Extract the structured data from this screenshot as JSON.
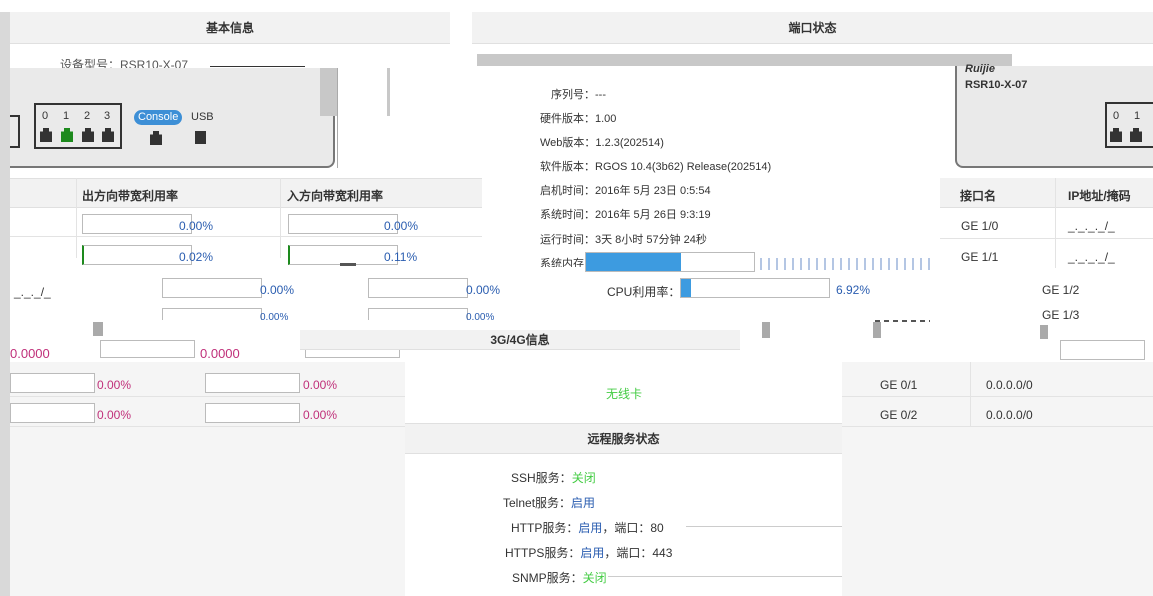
{
  "basic": {
    "title": "基本信息",
    "model_prefix": "设备型号：RSR10-X-07",
    "serial_label": "序列号：",
    "serial_value": "---",
    "hw_label": "硬件版本：",
    "hw_value": "1.00",
    "web_label": "Web版本：",
    "web_value": "1.2.3(202514)",
    "sw_label": "软件版本：",
    "sw_value": "RGOS 10.4(3b62) Release(202514)",
    "boot_label": "启机时间：",
    "boot_value": "2016年 5月 23日 0:5:54",
    "systime_label": "系统时间：",
    "systime_value": "2016年 5月 26日 9:3:19",
    "uptime_label": "运行时间：",
    "uptime_value": "3天 8小时 57分钟 24秒",
    "mem_label": "系统内存：",
    "cpu_label": "CPU利用率：",
    "cpu_pct": "6.92%",
    "cpu_fraction": 0.0692
  },
  "port_status": {
    "title": "端口状态",
    "brand": "Ruijie",
    "model": "RSR10-X-07",
    "port_numbers": [
      "0",
      "1",
      "2",
      "3"
    ],
    "console_label": "Console",
    "usb_label": "USB",
    "right_port_numbers": [
      "0",
      "1"
    ]
  },
  "bandwidth": {
    "out_header": "出方向带宽利用率",
    "in_header": "入方向带宽利用率",
    "rows": [
      {
        "out": "0.00%",
        "in": "0.00%",
        "out_frac": 0.0,
        "in_frac": 0.0
      },
      {
        "out": "0.02%",
        "in": "0.11%",
        "out_frac": 0.0002,
        "in_frac": 0.0011
      },
      {
        "out": "0.00%",
        "in": "0.00%",
        "out_frac": 0.0,
        "in_frac": 0.0
      },
      {
        "out": "0.00%",
        "in": "0.00%",
        "out_frac": 0.0,
        "in_frac": 0.0
      }
    ],
    "magenta_rows": [
      {
        "out": "0.00%",
        "in": "0.00%"
      },
      {
        "out": "0.00%",
        "in": "0.00%"
      }
    ],
    "partial_left": "_._._/_",
    "partial_mid_a": "0.0000",
    "partial_mid_b": "0.0000"
  },
  "interfaces": {
    "name_header": "接口名",
    "ip_header": "IP地址/掩码",
    "rows": [
      {
        "name": "GE 1/0",
        "ip": "_._._._/_"
      },
      {
        "name": "GE 1/1",
        "ip": "_._._._/_"
      },
      {
        "name": "GE 1/2",
        "ip": ""
      },
      {
        "name": "GE 1/3",
        "ip": ""
      }
    ],
    "lower_rows": [
      {
        "name": "GE 0/1",
        "ip": "0.0.0.0/0"
      },
      {
        "name": "GE 0/2",
        "ip": "0.0.0.0/0"
      }
    ]
  },
  "g34": {
    "title": "3G/4G信息",
    "value": "无线卡"
  },
  "remote": {
    "title": "远程服务状态",
    "items": [
      {
        "label": "SSH服务：",
        "value": "关闭",
        "extra": ""
      },
      {
        "label": "Telnet服务：",
        "value": "启用",
        "extra": ""
      },
      {
        "label": "HTTP服务：",
        "value": "启用",
        "extra": "，端口：80"
      },
      {
        "label": "HTTPS服务：",
        "value": "启用",
        "extra": "，端口：443"
      },
      {
        "label": "SNMP服务：",
        "value": "关闭",
        "extra": ""
      }
    ]
  }
}
